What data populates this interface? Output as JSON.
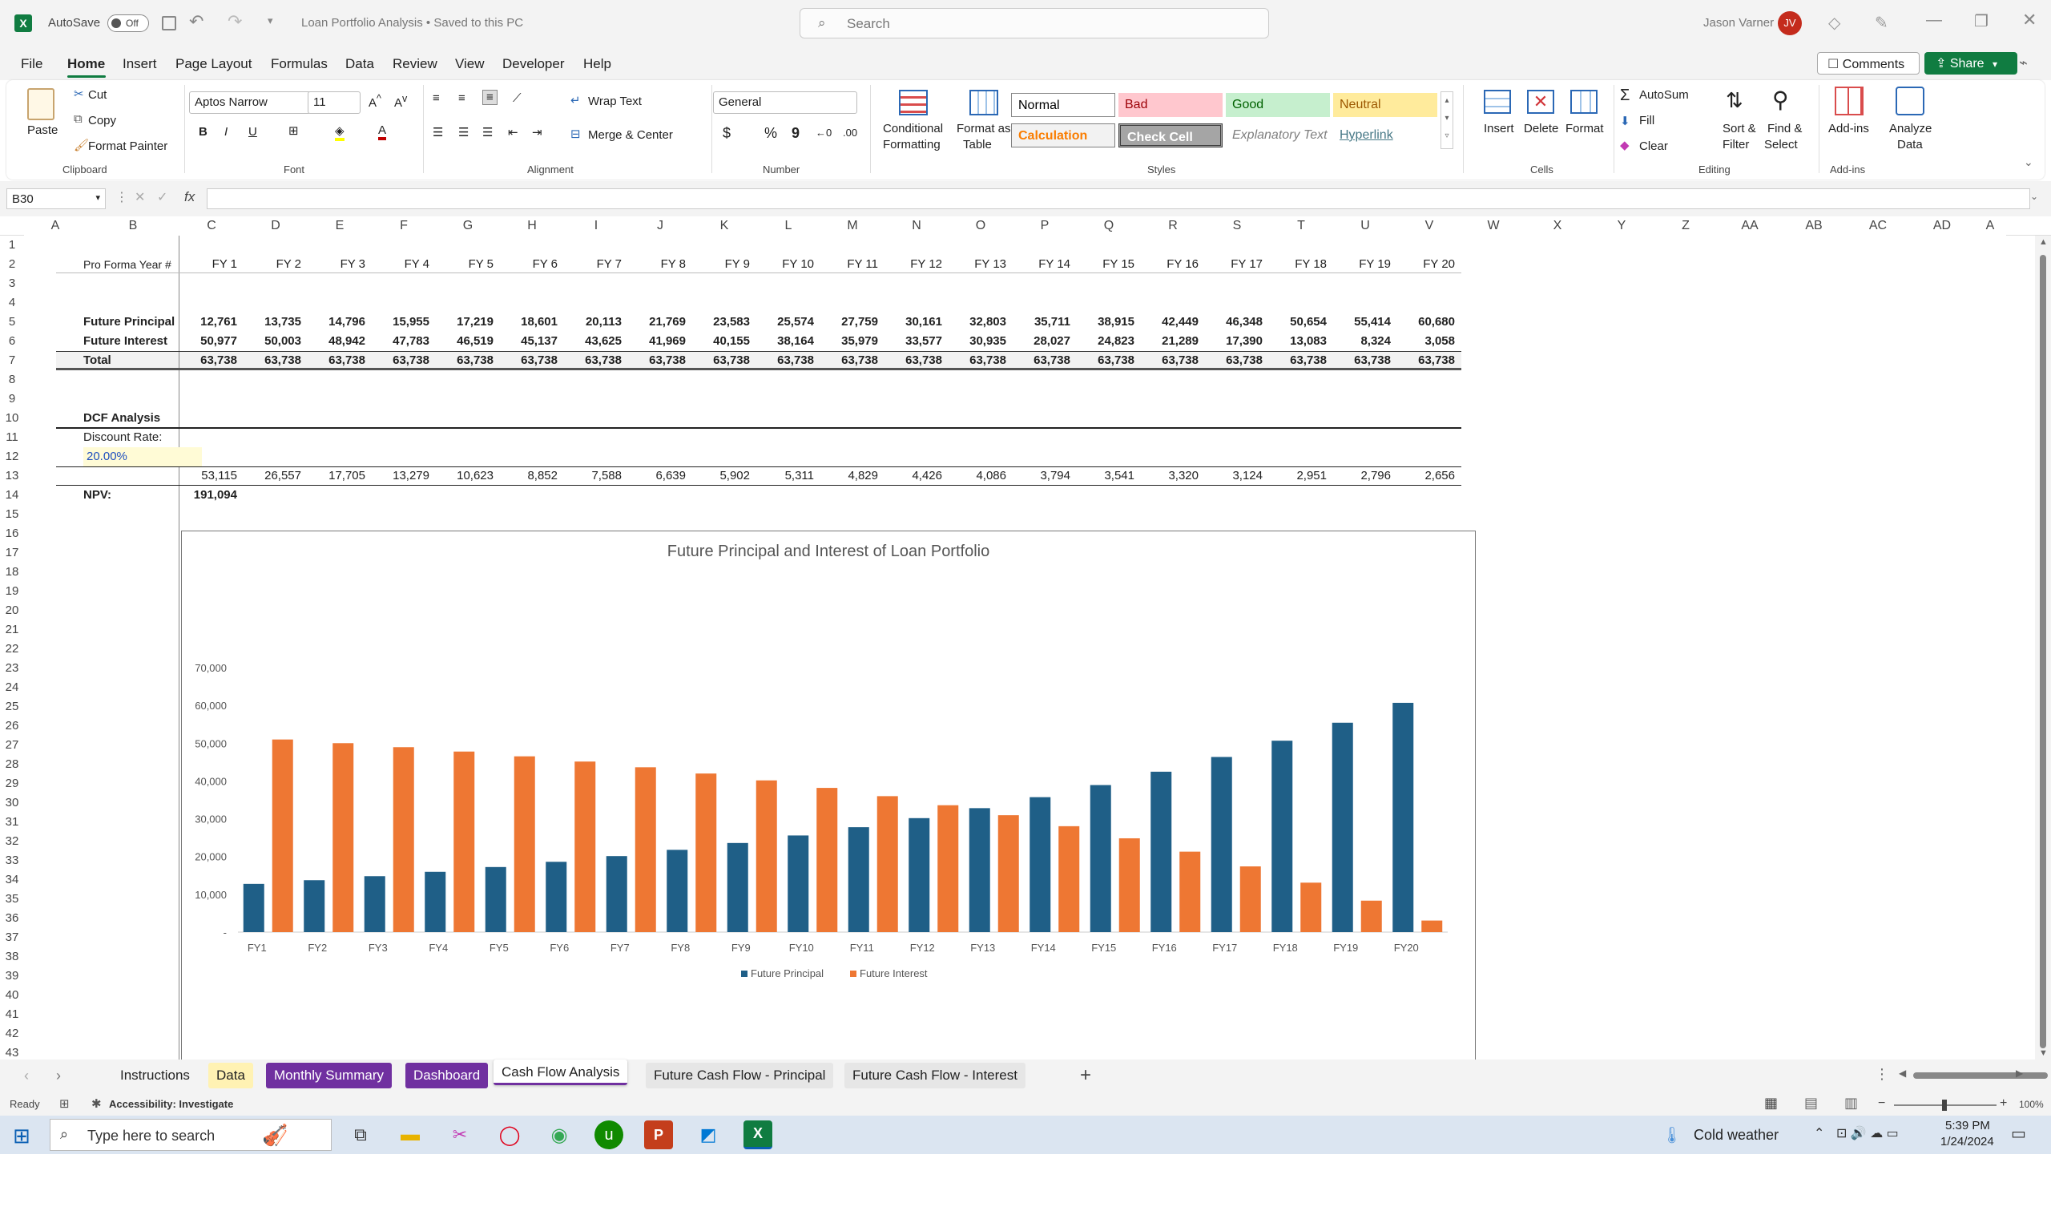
{
  "title_bar": {
    "autosave_label": "AutoSave",
    "autosave_state": "Off",
    "doc_title": "Loan Portfolio Analysis • Saved to this PC",
    "search_placeholder": "Search",
    "user_name": "Jason Varner",
    "user_initials": "JV"
  },
  "menu": [
    "File",
    "Home",
    "Insert",
    "Page Layout",
    "Formulas",
    "Data",
    "Review",
    "View",
    "Developer",
    "Help"
  ],
  "menu_right": {
    "comments": "Comments",
    "share": "Share"
  },
  "ribbon": {
    "clipboard": {
      "paste": "Paste",
      "cut": "Cut",
      "copy": "Copy",
      "format_painter": "Format Painter",
      "label": "Clipboard"
    },
    "font": {
      "name": "Aptos Narrow",
      "size": "11",
      "label": "Font"
    },
    "alignment": {
      "wrap": "Wrap Text",
      "merge": "Merge & Center",
      "label": "Alignment"
    },
    "number": {
      "format": "General",
      "label": "Number"
    },
    "styles": {
      "cond_format_1": "Conditional",
      "cond_format_2": "Formatting",
      "format_table_1": "Format as",
      "format_table_2": "Table",
      "normal": "Normal",
      "bad": "Bad",
      "good": "Good",
      "neutral": "Neutral",
      "calculation": "Calculation",
      "check_cell": "Check Cell",
      "explanatory": "Explanatory Text",
      "hyperlink": "Hyperlink",
      "label": "Styles"
    },
    "cells": {
      "insert": "Insert",
      "delete": "Delete",
      "format": "Format",
      "label": "Cells"
    },
    "editing": {
      "autosum": "AutoSum",
      "fill": "Fill",
      "clear": "Clear",
      "sort_1": "Sort &",
      "sort_2": "Filter",
      "find_1": "Find &",
      "find_2": "Select",
      "label": "Editing"
    },
    "addins": {
      "addins": "Add-ins",
      "analyze_1": "Analyze",
      "analyze_2": "Data",
      "label": "Add-ins"
    }
  },
  "formula_bar": {
    "name_box": "B30",
    "fx": "fx",
    "formula": ""
  },
  "columns": [
    "A",
    "B",
    "C",
    "D",
    "E",
    "F",
    "G",
    "H",
    "I",
    "J",
    "K",
    "L",
    "M",
    "N",
    "O",
    "P",
    "Q",
    "R",
    "S",
    "T",
    "U",
    "V",
    "W",
    "X",
    "Y",
    "Z",
    "AA",
    "AB",
    "AC",
    "AD",
    "A"
  ],
  "rows": [
    "1",
    "2",
    "3",
    "4",
    "5",
    "6",
    "7",
    "8",
    "9",
    "10",
    "11",
    "12",
    "13",
    "14",
    "15",
    "16",
    "17",
    "18",
    "19",
    "20",
    "21",
    "22",
    "23",
    "24",
    "25",
    "26",
    "27",
    "28",
    "29",
    "30",
    "31",
    "32",
    "33",
    "34",
    "35",
    "36",
    "37",
    "38",
    "39",
    "40",
    "41",
    "42",
    "43"
  ],
  "sheet": {
    "pro_forma_label": "Pro Forma Year #",
    "years": [
      "FY 1",
      "FY 2",
      "FY 3",
      "FY 4",
      "FY 5",
      "FY 6",
      "FY 7",
      "FY 8",
      "FY 9",
      "FY 10",
      "FY 11",
      "FY 12",
      "FY 13",
      "FY 14",
      "FY 15",
      "FY 16",
      "FY 17",
      "FY 18",
      "FY 19",
      "FY 20"
    ],
    "principal_label": "Future Principal",
    "principal": [
      "12,761",
      "13,735",
      "14,796",
      "15,955",
      "17,219",
      "18,601",
      "20,113",
      "21,769",
      "23,583",
      "25,574",
      "27,759",
      "30,161",
      "32,803",
      "35,711",
      "38,915",
      "42,449",
      "46,348",
      "50,654",
      "55,414",
      "60,680"
    ],
    "interest_label": "Future Interest",
    "interest": [
      "50,977",
      "50,003",
      "48,942",
      "47,783",
      "46,519",
      "45,137",
      "43,625",
      "41,969",
      "40,155",
      "38,164",
      "35,979",
      "33,577",
      "30,935",
      "28,027",
      "24,823",
      "21,289",
      "17,390",
      "13,083",
      "8,324",
      "3,058"
    ],
    "total_label": "Total",
    "totals": [
      "63,738",
      "63,738",
      "63,738",
      "63,738",
      "63,738",
      "63,738",
      "63,738",
      "63,738",
      "63,738",
      "63,738",
      "63,738",
      "63,738",
      "63,738",
      "63,738",
      "63,738",
      "63,738",
      "63,738",
      "63,738",
      "63,738",
      "63,738"
    ],
    "dcf_label": "DCF Analysis",
    "discount_label": "Discount Rate:",
    "discount_value": "20.00%",
    "pv": [
      "53,115",
      "26,557",
      "17,705",
      "13,279",
      "10,623",
      "8,852",
      "7,588",
      "6,639",
      "5,902",
      "5,311",
      "4,829",
      "4,426",
      "4,086",
      "3,794",
      "3,541",
      "3,320",
      "3,124",
      "2,951",
      "2,796",
      "2,656"
    ],
    "npv_label": "NPV:",
    "npv_value": "191,094"
  },
  "chart_data": {
    "type": "bar",
    "title": "Future Principal and Interest of Loan Portfolio",
    "categories": [
      "FY1",
      "FY2",
      "FY3",
      "FY4",
      "FY5",
      "FY6",
      "FY7",
      "FY8",
      "FY9",
      "FY10",
      "FY11",
      "FY12",
      "FY13",
      "FY14",
      "FY15",
      "FY16",
      "FY17",
      "FY18",
      "FY19",
      "FY20"
    ],
    "series": [
      {
        "name": "Future Principal",
        "color": "#1f5f87",
        "values": [
          12761,
          13735,
          14796,
          15955,
          17219,
          18601,
          20113,
          21769,
          23583,
          25574,
          27759,
          30161,
          32803,
          35711,
          38915,
          42449,
          46348,
          50654,
          55414,
          60680
        ]
      },
      {
        "name": "Future Interest",
        "color": "#ee7733",
        "values": [
          50977,
          50003,
          48942,
          47783,
          46519,
          45137,
          43625,
          41969,
          40155,
          38164,
          35979,
          33577,
          30935,
          28027,
          24823,
          21289,
          17390,
          13083,
          8324,
          3058
        ]
      }
    ],
    "ylim": [
      0,
      70000
    ],
    "y_ticks": [
      "-",
      "10,000",
      "20,000",
      "30,000",
      "40,000",
      "50,000",
      "60,000",
      "70,000"
    ],
    "legend": "bottom",
    "grid": false
  },
  "tabs": [
    {
      "label": "Instructions",
      "bg": "#f3f3f3",
      "color": "#222"
    },
    {
      "label": "Data",
      "bg": "#fff2b3",
      "color": "#222"
    },
    {
      "label": "Monthly Summary",
      "bg": "#7030a0",
      "color": "#ffffff"
    },
    {
      "label": "Dashboard",
      "bg": "#7030a0",
      "color": "#ffffff"
    },
    {
      "label": "Cash Flow Analysis",
      "bg": "#ffffff",
      "color": "#222"
    },
    {
      "label": "Future Cash Flow - Principal",
      "bg": "#e6e6e6",
      "color": "#222"
    },
    {
      "label": "Future Cash Flow - Interest",
      "bg": "#e6e6e6",
      "color": "#222"
    }
  ],
  "status": {
    "ready": "Ready",
    "accessibility": "Accessibility: Investigate",
    "zoom": "100%"
  },
  "taskbar": {
    "search_placeholder": "Type here to search",
    "weather": "Cold weather",
    "time": "5:39 PM",
    "date": "1/24/2024"
  }
}
